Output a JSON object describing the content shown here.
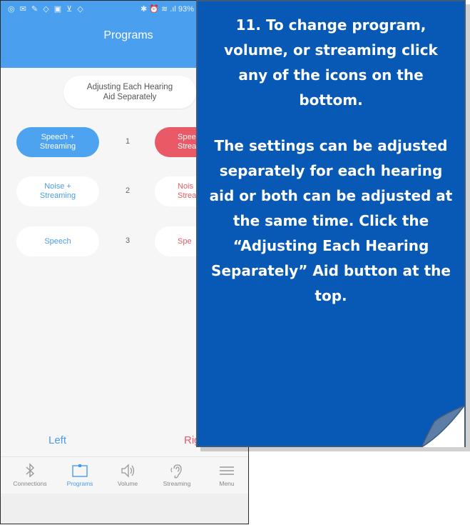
{
  "status_bar": {
    "left_icons": "◎ ✉ ✎ ◇ ▣ ⊻ ◇",
    "right_text": "✱ ⏰ ≋ .ıl 93%"
  },
  "header": {
    "title": "Programs"
  },
  "adjust_button": {
    "label": "Adjusting Each Hearing Aid Separately"
  },
  "programs": [
    {
      "number": "1",
      "left_label": "Speech + Streaming",
      "right_label": "Spee Strea"
    },
    {
      "number": "2",
      "left_label": "Noise + Streaming",
      "right_label": "Nois Strea"
    },
    {
      "number": "3",
      "left_label": "Speech",
      "right_label": "Spe"
    }
  ],
  "sides": {
    "left": "Left",
    "right": "Rig"
  },
  "bottom_nav": [
    {
      "label": "Connections",
      "icon": "bluetooth-icon"
    },
    {
      "label": "Programs",
      "icon": "programs-icon"
    },
    {
      "label": "Volume",
      "icon": "volume-icon"
    },
    {
      "label": "Streaming",
      "icon": "hearing-icon"
    },
    {
      "label": "Menu",
      "icon": "menu-icon"
    }
  ],
  "callout": {
    "paragraph_1": "11. To change program, volume, or streaming click any of the icons on the bottom.",
    "paragraph_2": "The settings can be adjusted separately for each hearing aid or both can be adjusted at the same time. Click the “Adjusting Each Hearing Separately” Aid button at the top."
  },
  "colors": {
    "header_blue": "#4aa0ee",
    "left_accent": "#4a9cea",
    "right_accent": "#ea5a66",
    "callout_bg": "#0858b6"
  }
}
